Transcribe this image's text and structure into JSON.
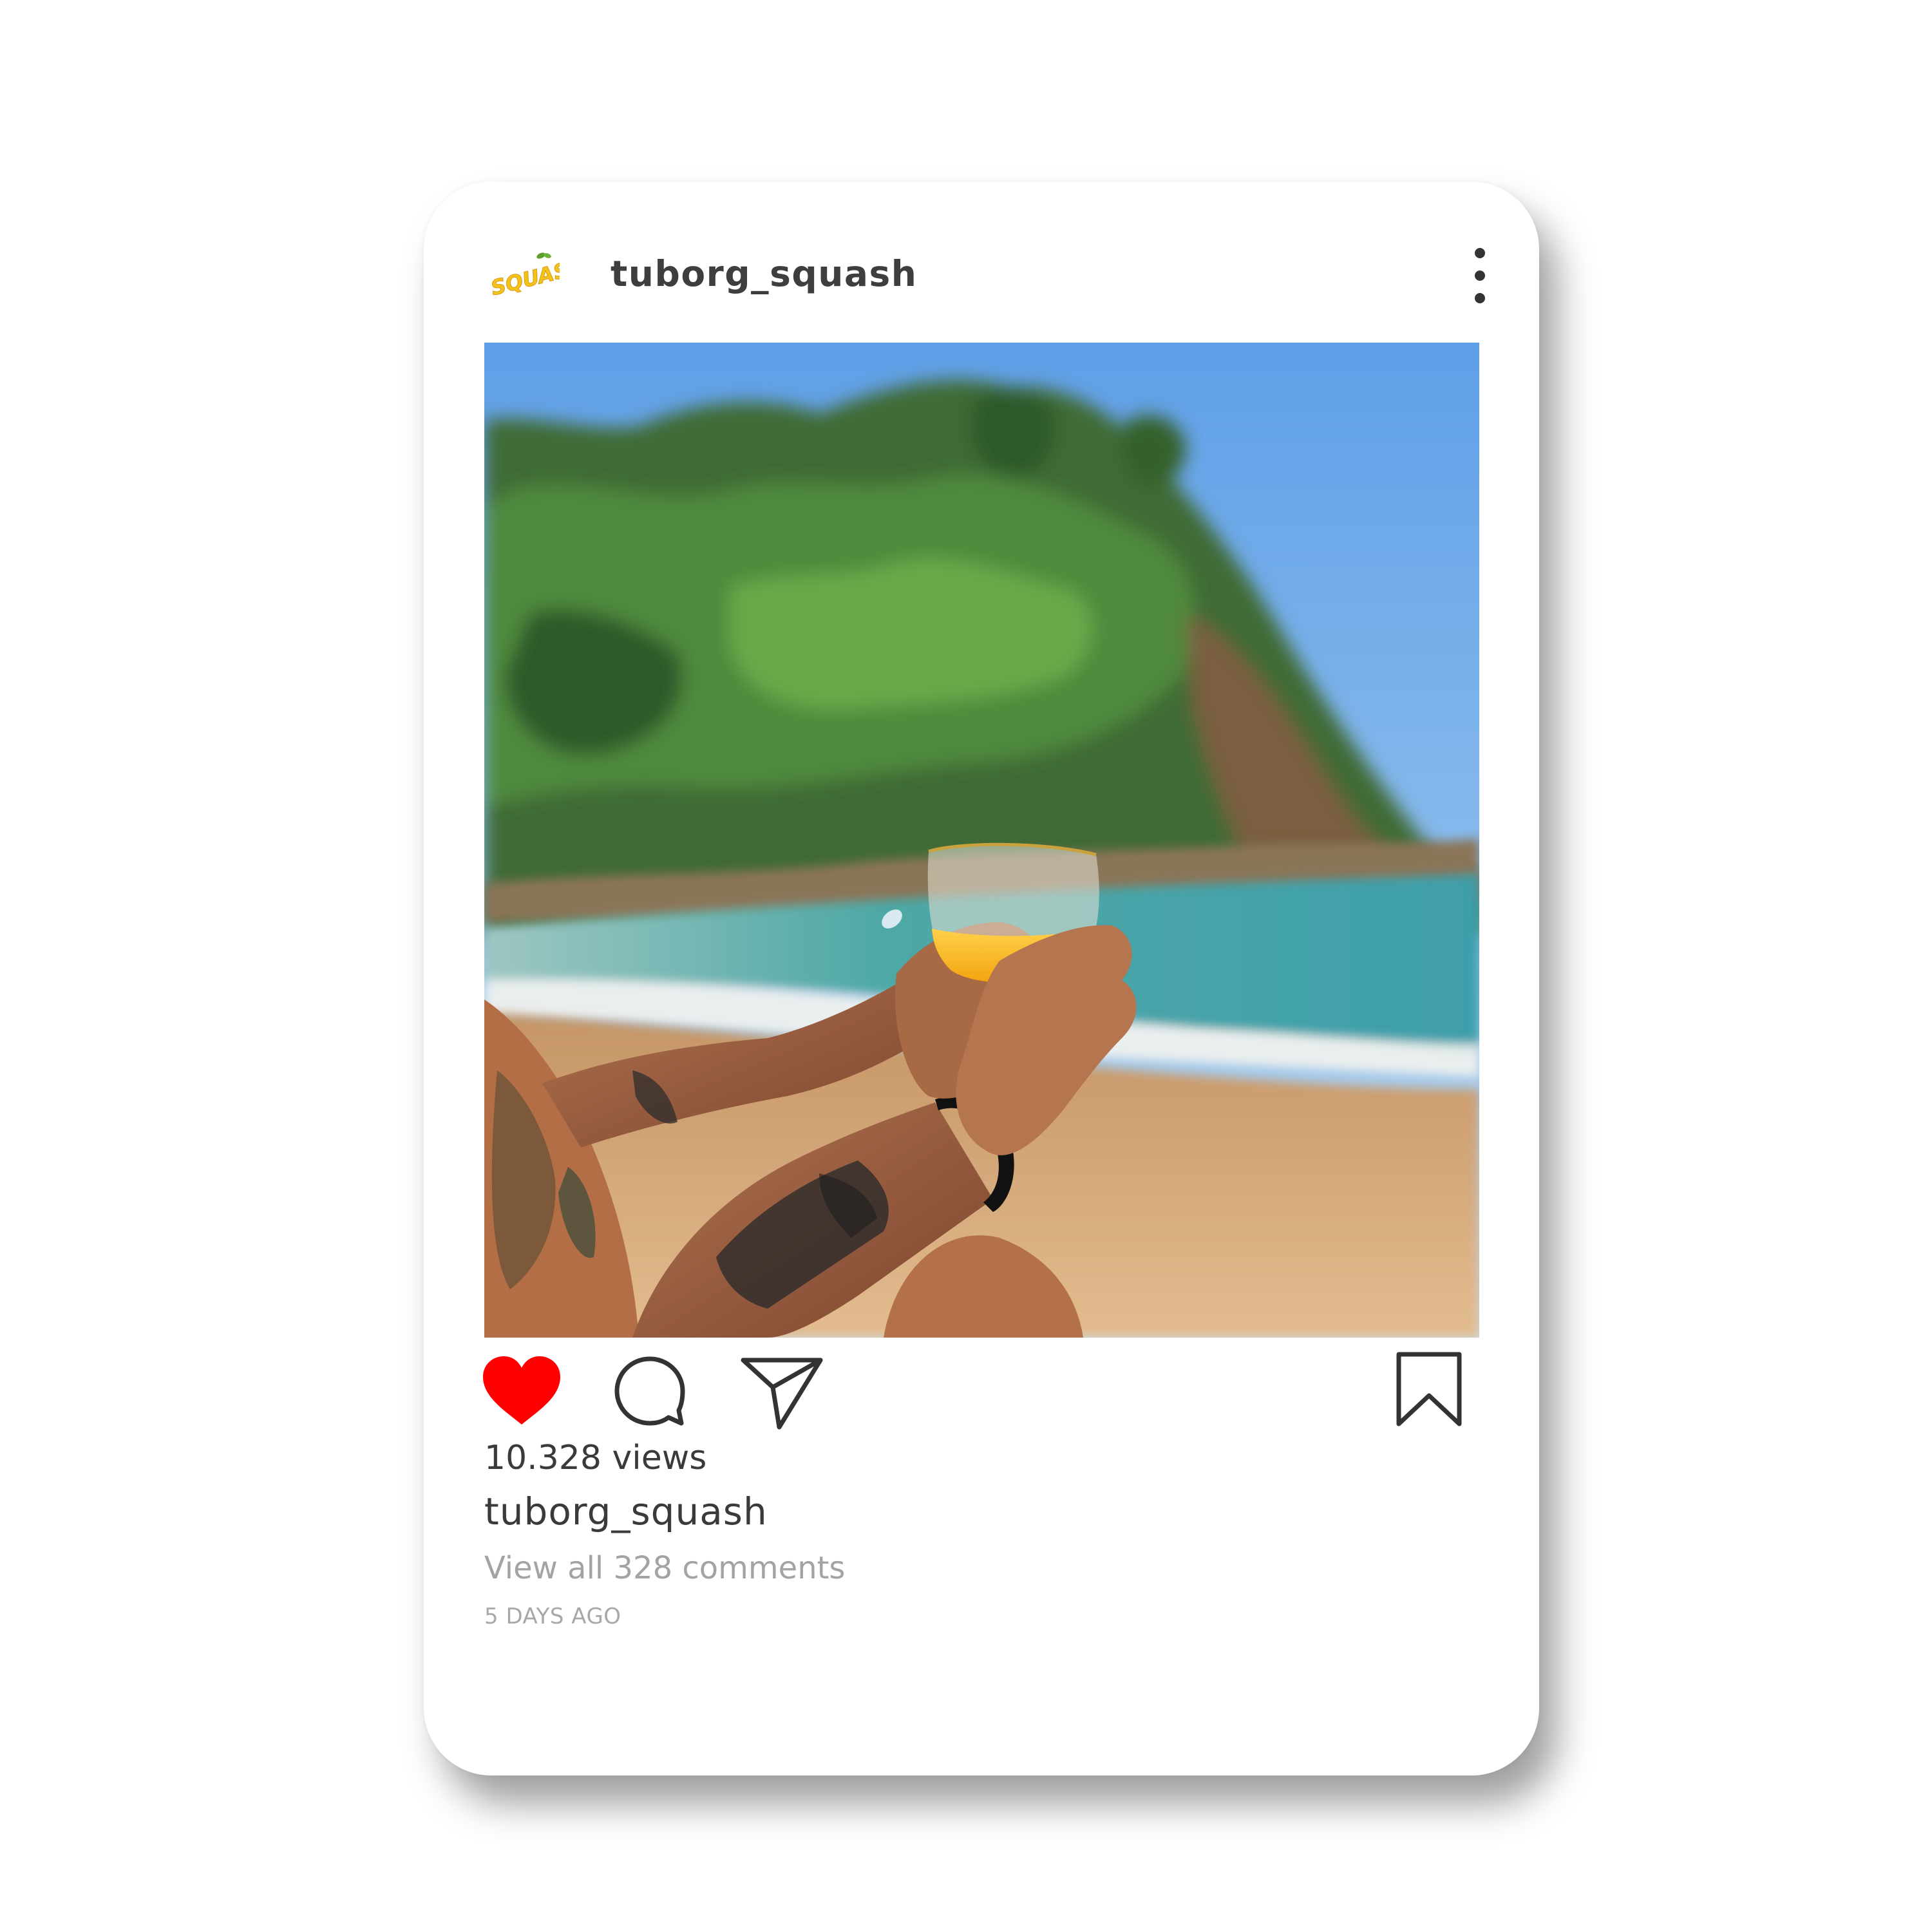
{
  "post": {
    "username": "tuborg_squash",
    "avatar": {
      "brand_text": "SQUASH",
      "brand_color": "#f3c31b"
    },
    "menu_icon": "more-vertical-icon",
    "photo_alt": "",
    "actions": {
      "like_icon": "heart-icon",
      "like_color": "#ff0000",
      "liked": true,
      "comment_icon": "comment-icon",
      "share_icon": "send-icon",
      "save_icon": "bookmark-icon"
    },
    "views": "10.328 views",
    "caption_username": "tuborg_squash",
    "comments_link": "View all 328 comments",
    "timestamp": "5 DAYS AGO"
  }
}
